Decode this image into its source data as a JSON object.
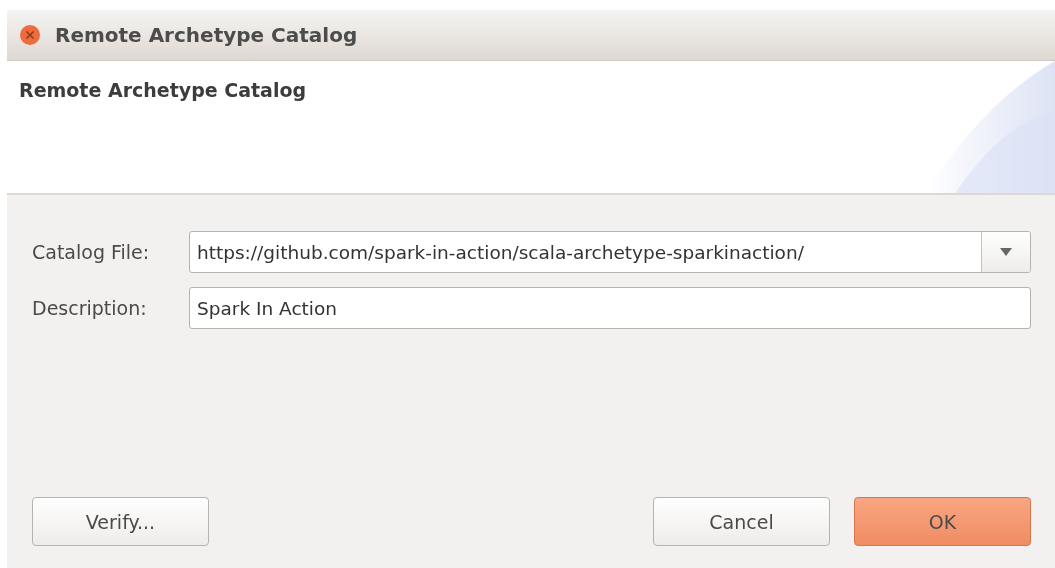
{
  "window": {
    "title": "Remote Archetype Catalog"
  },
  "header": {
    "title": "Remote Archetype Catalog"
  },
  "fields": [
    {
      "kind": "combo",
      "label": "Catalog File:",
      "value": "https://github.com/spark-in-action/scala-archetype-sparkinaction/"
    },
    {
      "kind": "text",
      "label": "Description:",
      "value": "Spark In Action"
    }
  ],
  "buttons": [
    {
      "label": "Verify...",
      "kind": "normal"
    },
    {
      "label": "Cancel",
      "kind": "normal"
    },
    {
      "label": "OK",
      "kind": "default"
    }
  ]
}
